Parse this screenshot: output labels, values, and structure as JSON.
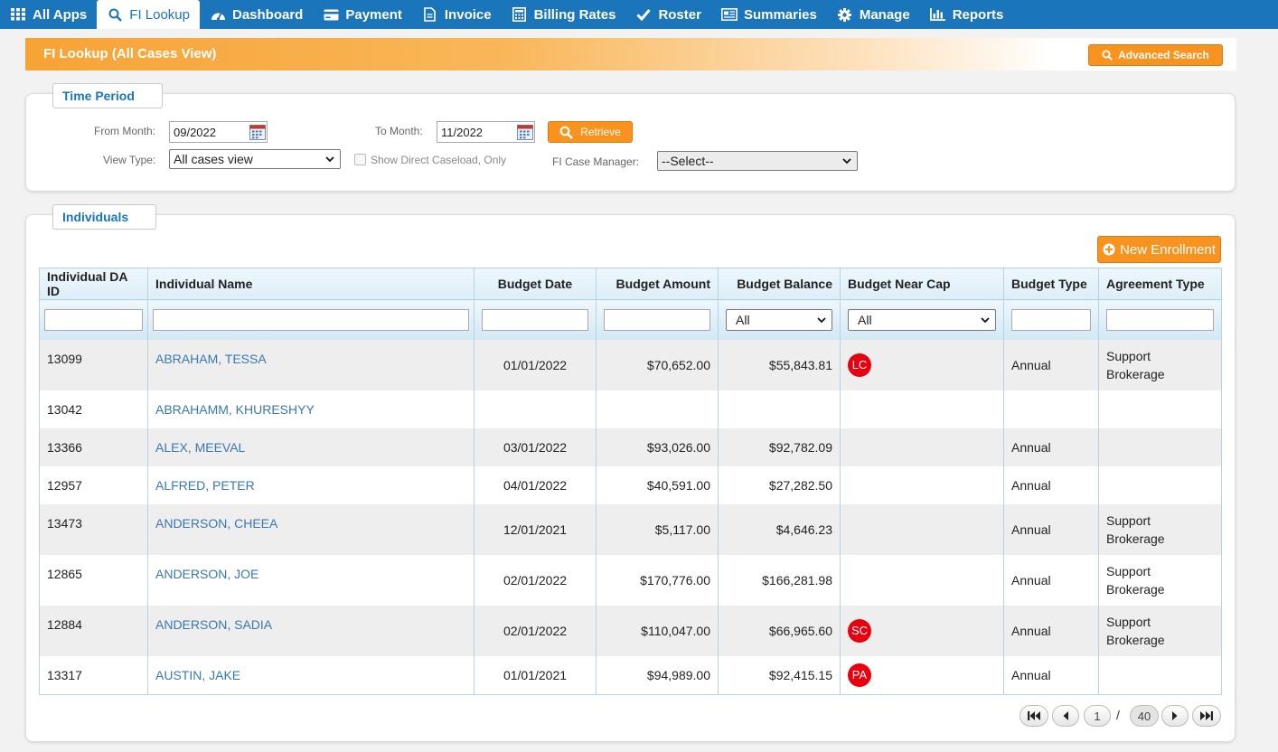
{
  "nav": {
    "items": [
      {
        "label": "All Apps",
        "icon": "grid-icon"
      },
      {
        "label": "FI Lookup",
        "icon": "search-icon"
      },
      {
        "label": "Dashboard",
        "icon": "dashboard-icon"
      },
      {
        "label": "Payment",
        "icon": "credit-card-icon"
      },
      {
        "label": "Invoice",
        "icon": "document-icon"
      },
      {
        "label": "Billing Rates",
        "icon": "calculator-icon"
      },
      {
        "label": "Roster",
        "icon": "checkmark-icon"
      },
      {
        "label": "Summaries",
        "icon": "newspaper-icon"
      },
      {
        "label": "Manage",
        "icon": "gear-icon"
      },
      {
        "label": "Reports",
        "icon": "bar-chart-icon"
      }
    ],
    "active": "FI Lookup"
  },
  "header": {
    "title": "FI Lookup (All Cases View)",
    "advanced_search_label": "Advanced Search"
  },
  "time_period": {
    "legend": "Time Period",
    "from_month_label": "From Month:",
    "from_month_value": "09/2022",
    "to_month_label": "To Month:",
    "to_month_value": "11/2022",
    "retrieve_label": "Retrieve",
    "view_type_label": "View Type:",
    "view_type_value": "All cases view",
    "direct_caseload_label": "Show Direct Caseload, Only",
    "case_manager_label": "FI Case Manager:",
    "case_manager_value": "--Select--"
  },
  "individuals": {
    "legend": "Individuals",
    "new_enrollment_label": "New Enrollment",
    "columns": [
      "Individual DA ID",
      "Individual Name",
      "Budget Date",
      "Budget Amount",
      "Budget Balance",
      "Budget Near Cap",
      "Budget Type",
      "Agreement Type"
    ],
    "filters": {
      "budget_balance": "All",
      "budget_near_cap": "All"
    },
    "rows": [
      {
        "id": "13099",
        "name": "ABRAHAM, TESSA",
        "date": "01/01/2022",
        "amount": "$70,652.00",
        "balance": "$55,843.81",
        "cap": "LC",
        "type": "Annual",
        "agreement1": "Support",
        "agreement2": "Brokerage"
      },
      {
        "id": "13042",
        "name": "ABRAHAMM, KHURESHYY",
        "date": "",
        "amount": "",
        "balance": "",
        "cap": "",
        "type": "",
        "agreement1": "",
        "agreement2": ""
      },
      {
        "id": "13366",
        "name": "ALEX, MEEVAL",
        "date": "03/01/2022",
        "amount": "$93,026.00",
        "balance": "$92,782.09",
        "cap": "",
        "type": "Annual",
        "agreement1": "",
        "agreement2": ""
      },
      {
        "id": "12957",
        "name": "ALFRED, PETER",
        "date": "04/01/2022",
        "amount": "$40,591.00",
        "balance": "$27,282.50",
        "cap": "",
        "type": "Annual",
        "agreement1": "",
        "agreement2": ""
      },
      {
        "id": "13473",
        "name": "ANDERSON, CHEEA",
        "date": "12/01/2021",
        "amount": "$5,117.00",
        "balance": "$4,646.23",
        "cap": "",
        "type": "Annual",
        "agreement1": "Support",
        "agreement2": "Brokerage"
      },
      {
        "id": "12865",
        "name": "ANDERSON, JOE",
        "date": "02/01/2022",
        "amount": "$170,776.00",
        "balance": "$166,281.98",
        "cap": "",
        "type": "Annual",
        "agreement1": "Support",
        "agreement2": "Brokerage"
      },
      {
        "id": "12884",
        "name": "ANDERSON, SADIA",
        "date": "02/01/2022",
        "amount": "$110,047.00",
        "balance": "$66,965.60",
        "cap": "SC",
        "type": "Annual",
        "agreement1": "Support",
        "agreement2": "Brokerage"
      },
      {
        "id": "13317",
        "name": "AUSTIN, JAKE",
        "date": "01/01/2021",
        "amount": "$94,989.00",
        "balance": "$92,415.15",
        "cap": "PA",
        "type": "Annual",
        "agreement1": "",
        "agreement2": ""
      }
    ]
  },
  "pager": {
    "current_page": "1",
    "separator": "/",
    "total_pages": "40"
  },
  "colors": {
    "nav_bg": "#1a75bb",
    "accent_orange": "#f7931e",
    "link_blue": "#3a78ad",
    "cap_badge_red": "#e8000f"
  }
}
